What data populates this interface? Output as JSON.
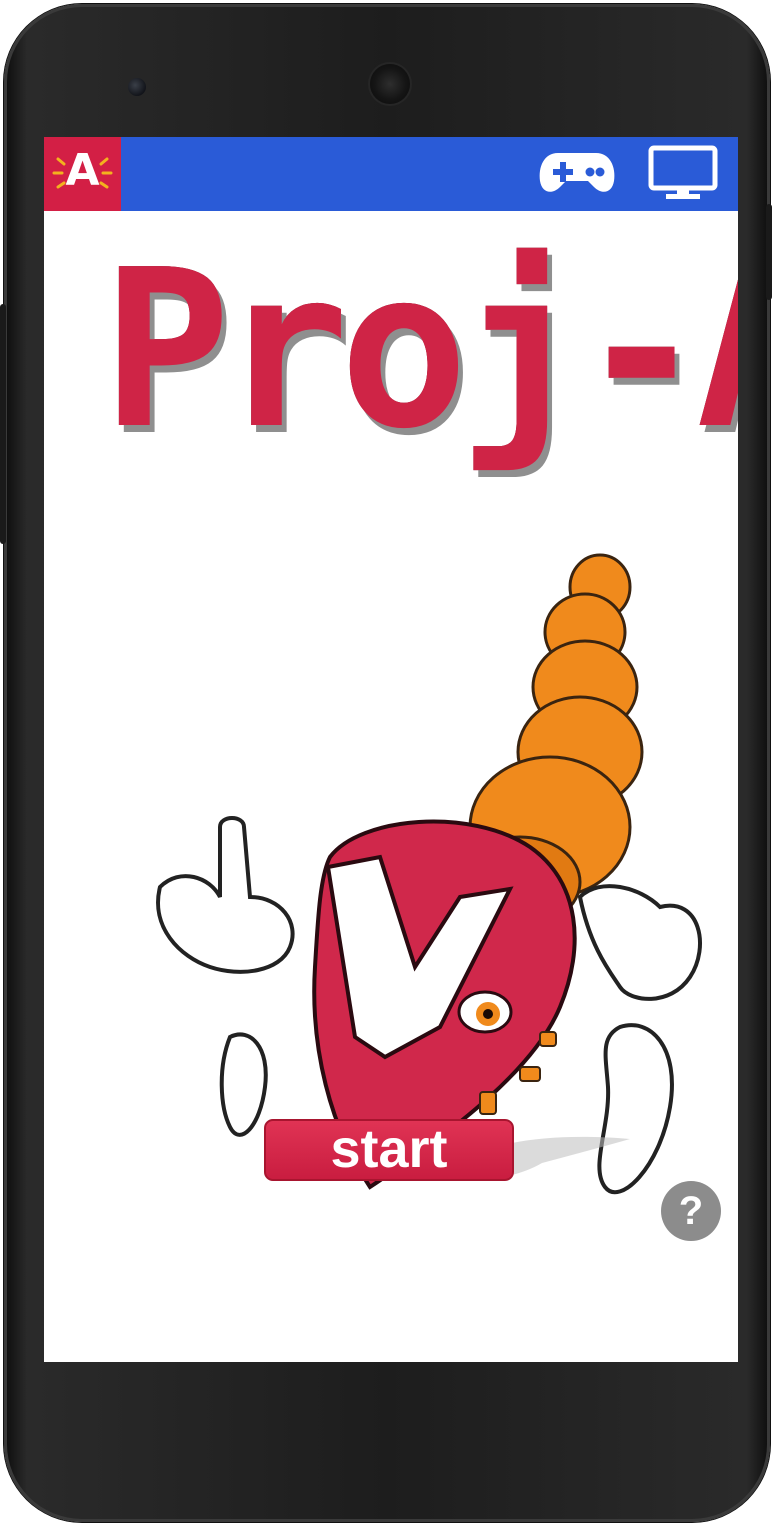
{
  "app": {
    "logo_letter": "A",
    "title": "Proj-A",
    "start_label": "start",
    "help_label": "?"
  },
  "topbar": {
    "color": "#2a5bd7",
    "icons": [
      "gamepad-icon",
      "monitor-icon"
    ]
  },
  "colors": {
    "brand_red": "#d31f45",
    "mascot_orange": "#f08a1c",
    "help_gray": "#8c8c8c"
  }
}
